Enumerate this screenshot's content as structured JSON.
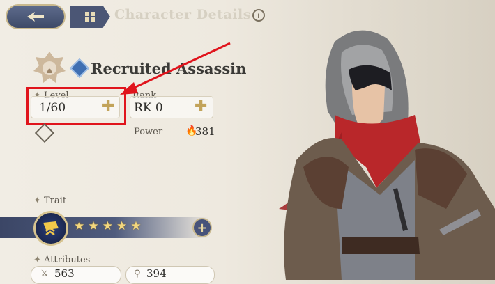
{
  "header": {
    "title": "Character Details",
    "info_icon": "i",
    "back_icon": "back-wing-icon",
    "menu_icon": "grid-icon"
  },
  "character": {
    "name": "Recruited Assassin",
    "class_icon": "crossed-daggers-icon"
  },
  "stats": {
    "level_label": "Level",
    "level_value": "1/60",
    "rank_label": "Rank",
    "rank_value": "RK 0",
    "power_label": "Power",
    "power_value": "381"
  },
  "trait": {
    "label": "Trait",
    "stars": [
      "★",
      "★",
      "★",
      "★",
      "★"
    ],
    "add_label": "+"
  },
  "attributes": {
    "label": "Attributes",
    "attack": "563",
    "defense": "394"
  },
  "colors": {
    "highlight": "#e0141c",
    "accent_gold": "#c2a35a",
    "banner_blue": "#4b5675"
  }
}
